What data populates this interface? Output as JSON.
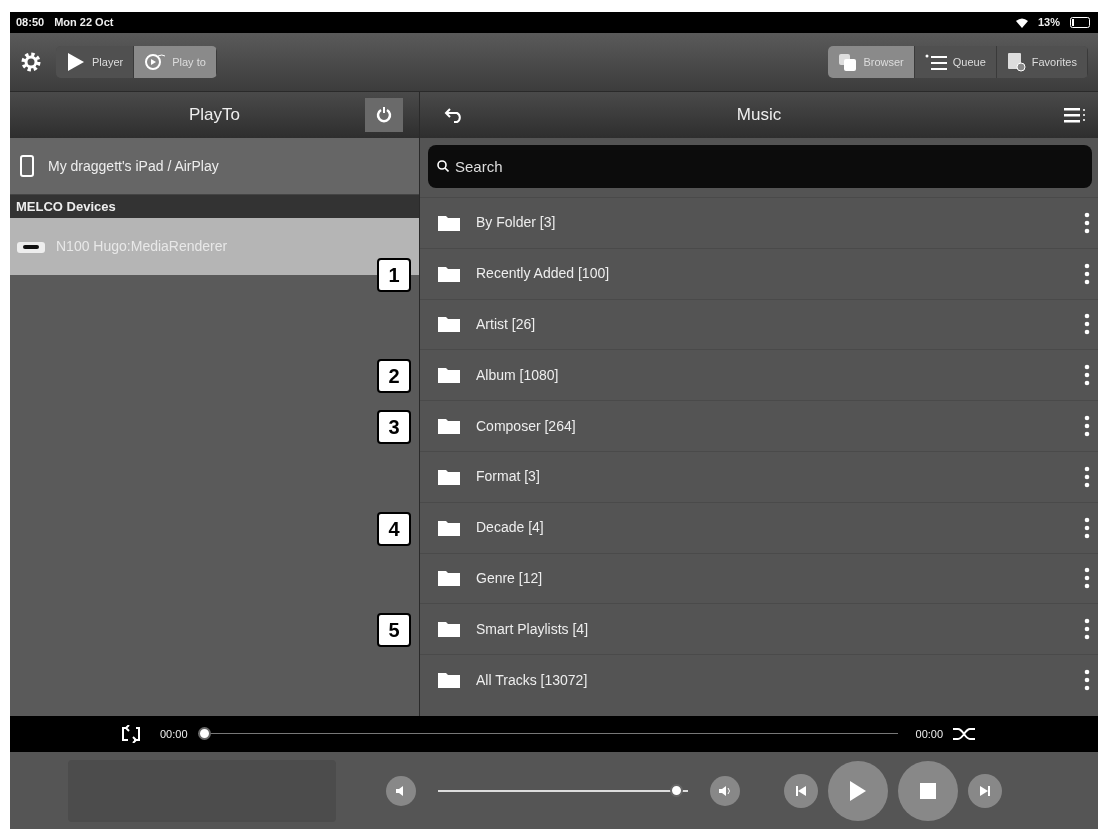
{
  "status_bar": {
    "time": "08:50",
    "date": "Mon 22 Oct",
    "battery": "13%"
  },
  "mode_tabs": [
    {
      "label": "Player",
      "kind": "play",
      "selected": false
    },
    {
      "label": "Play to",
      "kind": "playto",
      "selected": true
    }
  ],
  "view_tabs": [
    {
      "label": "Browser",
      "kind": "browser",
      "selected": true
    },
    {
      "label": "Queue",
      "kind": "queue",
      "selected": false
    },
    {
      "label": "Favorites",
      "kind": "favorites",
      "selected": false
    }
  ],
  "playto": {
    "title": "PlayTo",
    "device": "My draggett's iPad / AirPlay",
    "section": "MELCO Devices",
    "renderers": [
      {
        "label": "N100 Hugo:MediaRenderer",
        "selected": true
      }
    ]
  },
  "music": {
    "title": "Music",
    "search": {
      "placeholder": "Search"
    },
    "items": [
      {
        "label": "By Folder [3]"
      },
      {
        "label": "Recently Added [100]",
        "callout": "1"
      },
      {
        "label": "Artist [26]"
      },
      {
        "label": "Album [1080]",
        "callout": "2"
      },
      {
        "label": "Composer [264]",
        "callout": "3"
      },
      {
        "label": "Format [3]"
      },
      {
        "label": "Decade [4]",
        "callout": "4"
      },
      {
        "label": "Genre [12]"
      },
      {
        "label": "Smart Playlists [4]",
        "callout": "5"
      },
      {
        "label": "All Tracks [13072]"
      }
    ]
  },
  "player": {
    "elapsed": "00:00",
    "total": "00:00",
    "progress": {
      "level": 0
    },
    "volume": {
      "level": 0.98
    }
  }
}
